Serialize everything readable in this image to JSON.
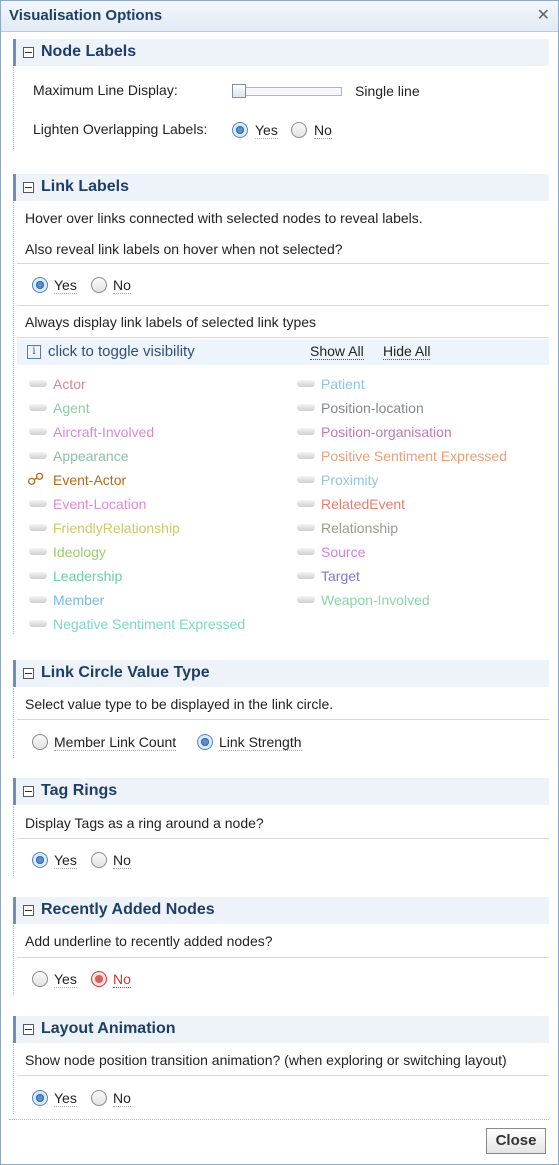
{
  "dialog": {
    "title": "Visualisation Options",
    "close_x": "✕",
    "close_button": "Close"
  },
  "node_labels": {
    "title": "Node Labels",
    "max_line_label": "Maximum Line Display:",
    "max_line_value": "Single line",
    "max_line_slider_level": 0,
    "lighten_label": "Lighten Overlapping Labels:",
    "yes": "Yes",
    "no": "No",
    "selected": "Yes"
  },
  "link_labels": {
    "title": "Link Labels",
    "hover_text": "Hover over links connected with selected nodes to reveal labels.",
    "also_reveal": "Also reveal link labels on hover when not selected?",
    "yes": "Yes",
    "no": "No",
    "selected": "Yes",
    "always_display": "Always display link labels of selected link types",
    "toggle_hint": "click to toggle visibility",
    "show_all": "Show All",
    "hide_all": "Hide All",
    "types_left": [
      {
        "label": "Actor",
        "color": "#d98a98"
      },
      {
        "label": "Agent",
        "color": "#8ccf9e"
      },
      {
        "label": "Aircraft-Involved",
        "color": "#d98ad0"
      },
      {
        "label": "Appearance",
        "color": "#8fbfa6"
      },
      {
        "label": "Event-Actor",
        "color": "#b06a1a",
        "active": true
      },
      {
        "label": "Event-Location",
        "color": "#e08ad6"
      },
      {
        "label": "FriendlyRelationship",
        "color": "#d2c76a"
      },
      {
        "label": "Ideology",
        "color": "#9ccd6a"
      },
      {
        "label": "Leadership",
        "color": "#6ccda6"
      },
      {
        "label": "Member",
        "color": "#7ab9e0"
      },
      {
        "label": "Negative Sentiment Expressed",
        "color": "#7ed6c6"
      }
    ],
    "types_right": [
      {
        "label": "Patient",
        "color": "#8ec6e0"
      },
      {
        "label": "Position-location",
        "color": "#808890"
      },
      {
        "label": "Position-organisation",
        "color": "#c07ab6"
      },
      {
        "label": "Positive Sentiment Expressed",
        "color": "#e6a07a"
      },
      {
        "label": "Proximity",
        "color": "#96c6dc"
      },
      {
        "label": "RelatedEvent",
        "color": "#e67e70"
      },
      {
        "label": "Relationship",
        "color": "#9a9a8a"
      },
      {
        "label": "Source",
        "color": "#d080e0"
      },
      {
        "label": "Target",
        "color": "#7a7ad6"
      },
      {
        "label": "Weapon-Involved",
        "color": "#8ad6a6"
      }
    ]
  },
  "link_circle": {
    "title": "Link Circle Value Type",
    "description": "Select value type to be displayed in the link circle.",
    "opt1": "Member Link Count",
    "opt2": "Link Strength",
    "selected": "Link Strength"
  },
  "tag_rings": {
    "title": "Tag Rings",
    "question": "Display Tags as a ring around a node?",
    "yes": "Yes",
    "no": "No",
    "selected": "Yes"
  },
  "recent_nodes": {
    "title": "Recently Added Nodes",
    "question": "Add underline to recently added nodes?",
    "yes": "Yes",
    "no": "No",
    "selected": "No"
  },
  "layout_anim": {
    "title": "Layout Animation",
    "question": "Show node position transition animation? (when exploring or switching layout)",
    "yes": "Yes",
    "no": "No",
    "selected": "Yes"
  }
}
